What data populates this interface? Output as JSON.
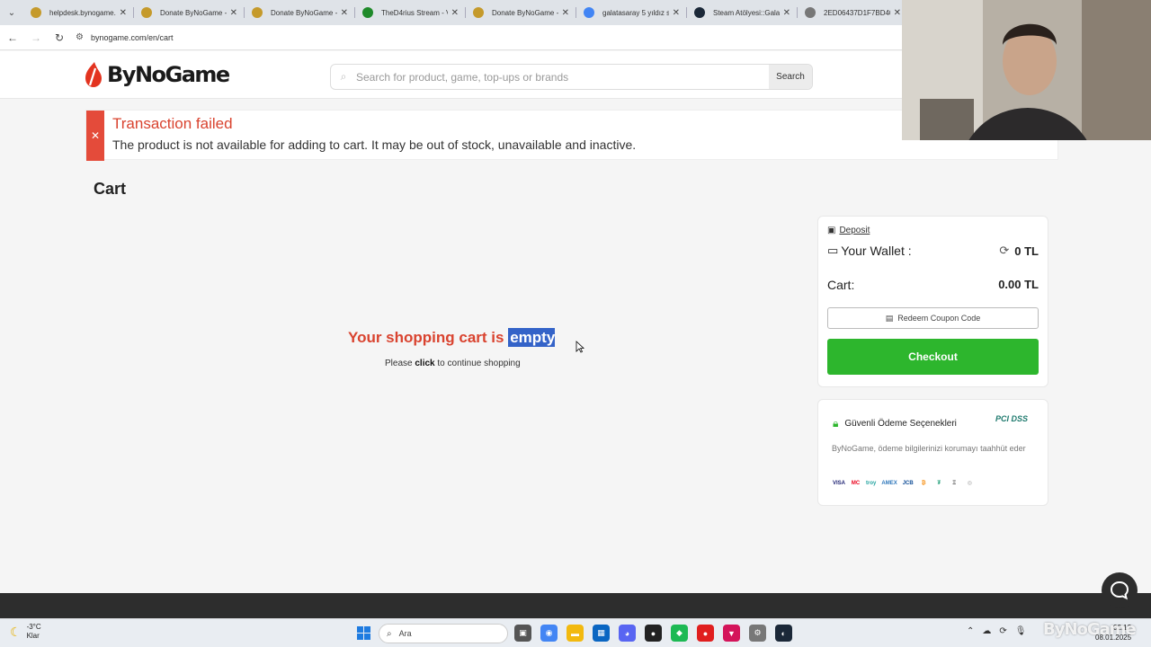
{
  "browser": {
    "tabs": [
      {
        "title": "helpdesk.bynogame.",
        "color": "#c59a2b"
      },
      {
        "title": "Donate ByNoGame -",
        "color": "#c59a2b"
      },
      {
        "title": "Donate ByNoGame -",
        "color": "#c59a2b"
      },
      {
        "title": "TheD4rius Stream - V",
        "color": "#1f8a2a"
      },
      {
        "title": "Donate ByNoGame -",
        "color": "#c59a2b"
      },
      {
        "title": "galatasaray 5 yıldız s",
        "color": "#4285f4"
      },
      {
        "title": "Steam Atölyesi::Galat",
        "color": "#1b2838"
      },
      {
        "title": "2ED06437D1F7BD40",
        "color": "#777777"
      }
    ],
    "url": "bynogame.com/en/cart"
  },
  "header": {
    "logo_text": "ByNoGame",
    "search_placeholder": "Search for product, game, top-ups or brands",
    "search_button": "Search"
  },
  "alert": {
    "title": "Transaction failed",
    "message": "The product is not available for adding to cart. It may be out of stock, unavailable and inactive.",
    "close_symbol": "✕",
    "color": "#e44b3a"
  },
  "cart": {
    "title": "Cart",
    "empty_prefix": "Your shopping cart is ",
    "empty_highlight": "empty",
    "continue_prefix": "Please ",
    "continue_link": "click",
    "continue_suffix": " to continue shopping"
  },
  "summary": {
    "deposit_label": "Deposit",
    "wallet_label": "Your Wallet :",
    "wallet_amount": "0 TL",
    "cart_label": "Cart:",
    "cart_amount": "0.00 TL",
    "coupon_label": "Redeem Coupon Code",
    "checkout_label": "Checkout",
    "checkout_color": "#2db62d"
  },
  "security": {
    "title": "Güvenli Ödeme Seçenekleri",
    "badge": "PCI DSS",
    "text": "ByNoGame, ödeme bilgilerinizi korumayı taahhüt eder",
    "payment_icons": [
      "VISA",
      "MC",
      "troy",
      "AMEX",
      "JCB",
      "₿",
      "₮",
      "Ξ",
      "◎"
    ]
  },
  "taskbar": {
    "weather_temp": "-3°C",
    "weather_desc": "Klar",
    "search_label": "Ara",
    "clock_time": "02:12",
    "clock_date": "08.01.2025"
  },
  "watermark": "ByNoGame"
}
